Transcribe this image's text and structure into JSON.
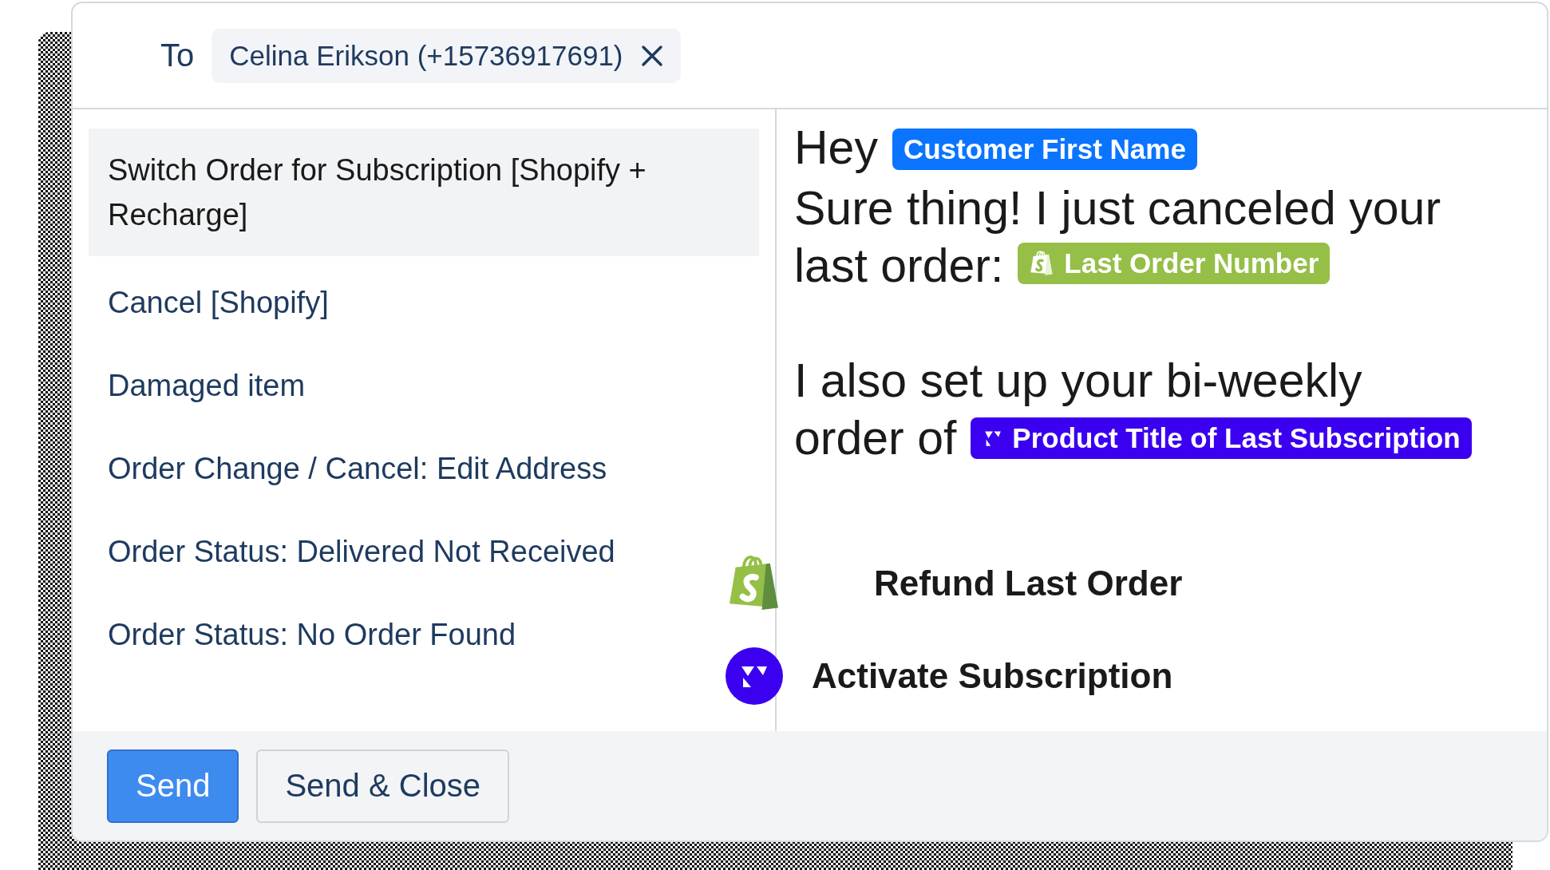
{
  "recipient": {
    "label": "To",
    "chip": "Celina Erikson (+15736917691)"
  },
  "macros": [
    {
      "title": "Switch Order for Subscription [Shopify + Recharge]",
      "selected": true
    },
    {
      "title": "Cancel [Shopify]",
      "selected": false
    },
    {
      "title": "Damaged item",
      "selected": false
    },
    {
      "title": "Order Change / Cancel: Edit Address",
      "selected": false
    },
    {
      "title": "Order Status: Delivered Not Received",
      "selected": false
    },
    {
      "title": "Order Status: No Order Found",
      "selected": false
    }
  ],
  "message": {
    "paragraphs": [
      [
        [
          {
            "kind": "text",
            "text": "Hey"
          },
          {
            "kind": "tag",
            "text": "Customer First Name",
            "color": "#0a74ff"
          }
        ]
      ],
      [
        [
          {
            "kind": "text",
            "text": "Sure thing! I just canceled your"
          }
        ],
        [
          {
            "kind": "text",
            "text": "last order:"
          },
          {
            "kind": "shopify",
            "text": "Last Order Number",
            "color": "#95bf47"
          }
        ]
      ],
      [
        [
          {
            "kind": "text",
            "text": "I also set up your bi-weekly"
          }
        ],
        [
          {
            "kind": "text",
            "text": "order of"
          },
          {
            "kind": "recharge",
            "text": "Product Title of Last Subscription",
            "color": "#3b00f0"
          }
        ]
      ]
    ]
  },
  "actions": [
    {
      "kind": "shopify",
      "label": "Refund Last Order"
    },
    {
      "kind": "recharge",
      "label": "Activate Subscription"
    }
  ],
  "buttons": [
    {
      "kind": "primary",
      "label": "Send"
    },
    {
      "kind": "secondary",
      "label": "Send & Close"
    }
  ]
}
